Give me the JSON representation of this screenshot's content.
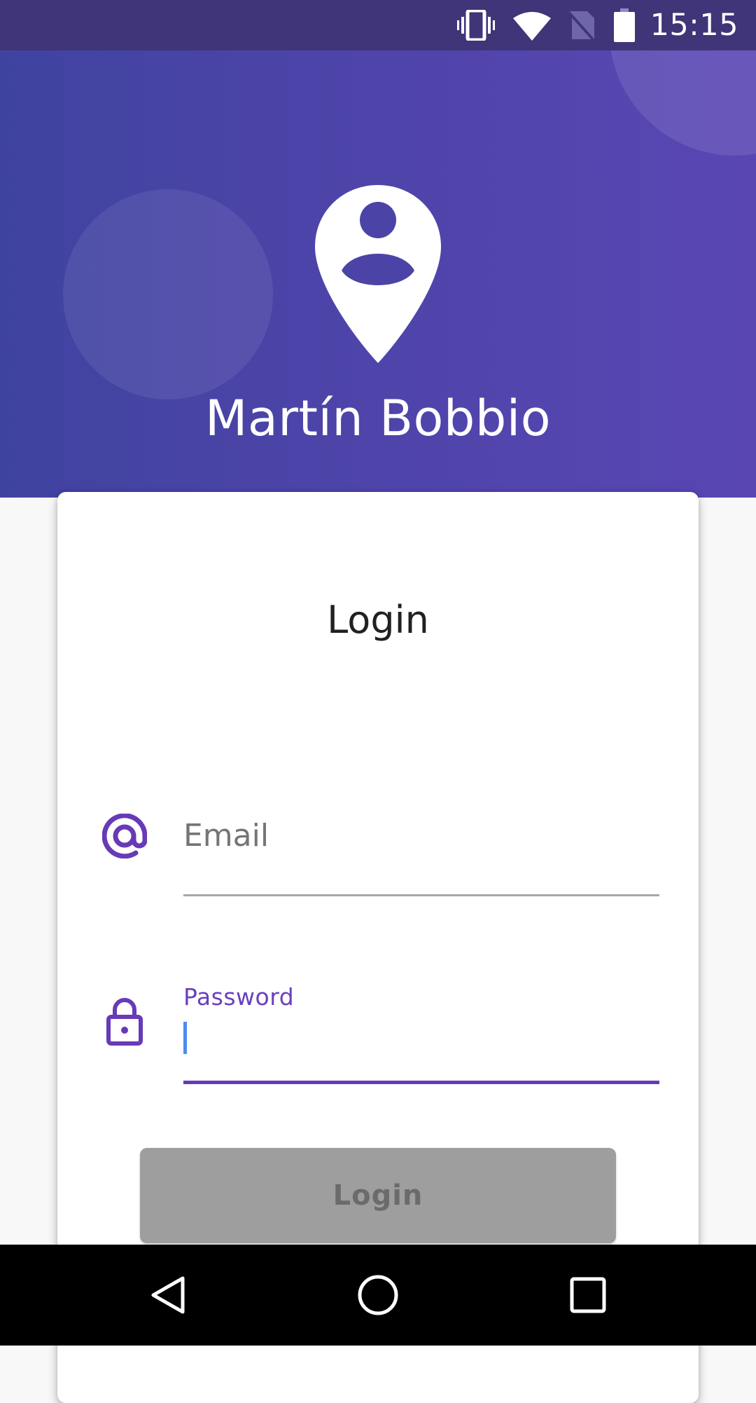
{
  "status_bar": {
    "time": "15:15",
    "icons": [
      "vibrate-icon",
      "wifi-icon",
      "no-sim-icon",
      "battery-icon"
    ]
  },
  "header": {
    "name": "Martín Bobbio",
    "logo": "user-location-pin-icon"
  },
  "login_card": {
    "title": "Login",
    "email": {
      "placeholder": "Email",
      "value": "",
      "icon": "at-sign-icon"
    },
    "password": {
      "label": "Password",
      "value": "",
      "icon": "lock-icon",
      "focused": true
    },
    "submit_label": "Login",
    "submit_enabled": false
  },
  "nav_bar": {
    "buttons": [
      "back-icon",
      "home-icon",
      "recents-icon"
    ]
  },
  "colors": {
    "status_bar": "#3f3578",
    "header_start": "#3f43a0",
    "header_end": "#5946b3",
    "accent": "#673ab7",
    "cursor": "#4a8cf0",
    "button_disabled": "#9e9e9e",
    "button_text_disabled": "#6b6b6b"
  }
}
